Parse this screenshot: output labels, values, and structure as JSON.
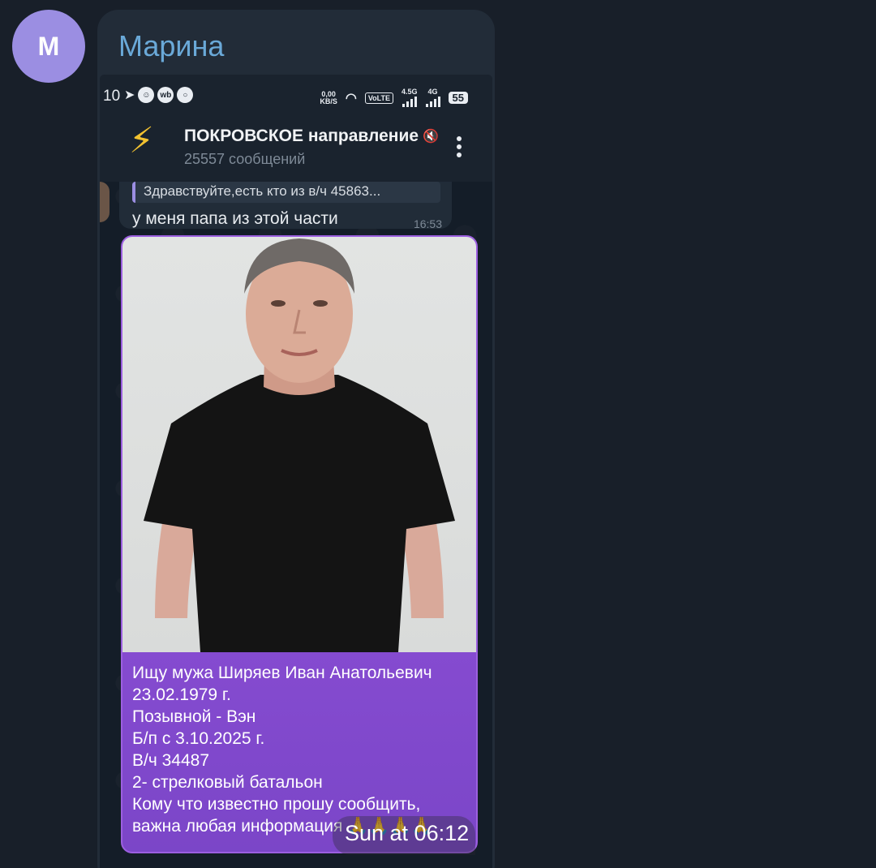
{
  "sender": {
    "avatar_letter": "M",
    "name": "Марина"
  },
  "screenshot": {
    "statusbar": {
      "time": "10",
      "left_icons": [
        "telegram-icon",
        "smiley-icon",
        "wb-icon",
        "chat-bubble-icon"
      ],
      "speed_top": "0,00",
      "speed_bottom": "KB/S",
      "volte": "VoLTE",
      "net1": "4.5G",
      "net2": "4G",
      "battery": "55"
    },
    "channel": {
      "title": "ПОКРОВСКОЕ направление",
      "subtitle": "25557 сообщений"
    },
    "message": {
      "reply_preview": "Здравствуйте,есть кто из в/ч 45863...",
      "text": "у меня папа из этой части",
      "time": "16:53"
    },
    "post": {
      "caption_lines": [
        "Ищу мужа Ширяев Иван Анатольевич",
        "23.02.1979 г.",
        "Позывной - Вэн",
        "Б/п с 3.10.2025 г.",
        "В/ч 34487",
        "2- стрелковый батальон",
        "Кому что известно прошу сообщить,",
        "важна любая информация 🙏🙏🙏🙏"
      ]
    }
  },
  "bubble_timestamp": "Sun at 06:12",
  "colors": {
    "avatar": "#9b8ee2",
    "sender_name": "#6aa9d8",
    "post_gradient_top": "#9a55e0",
    "post_gradient_bottom": "#7b46c8"
  }
}
